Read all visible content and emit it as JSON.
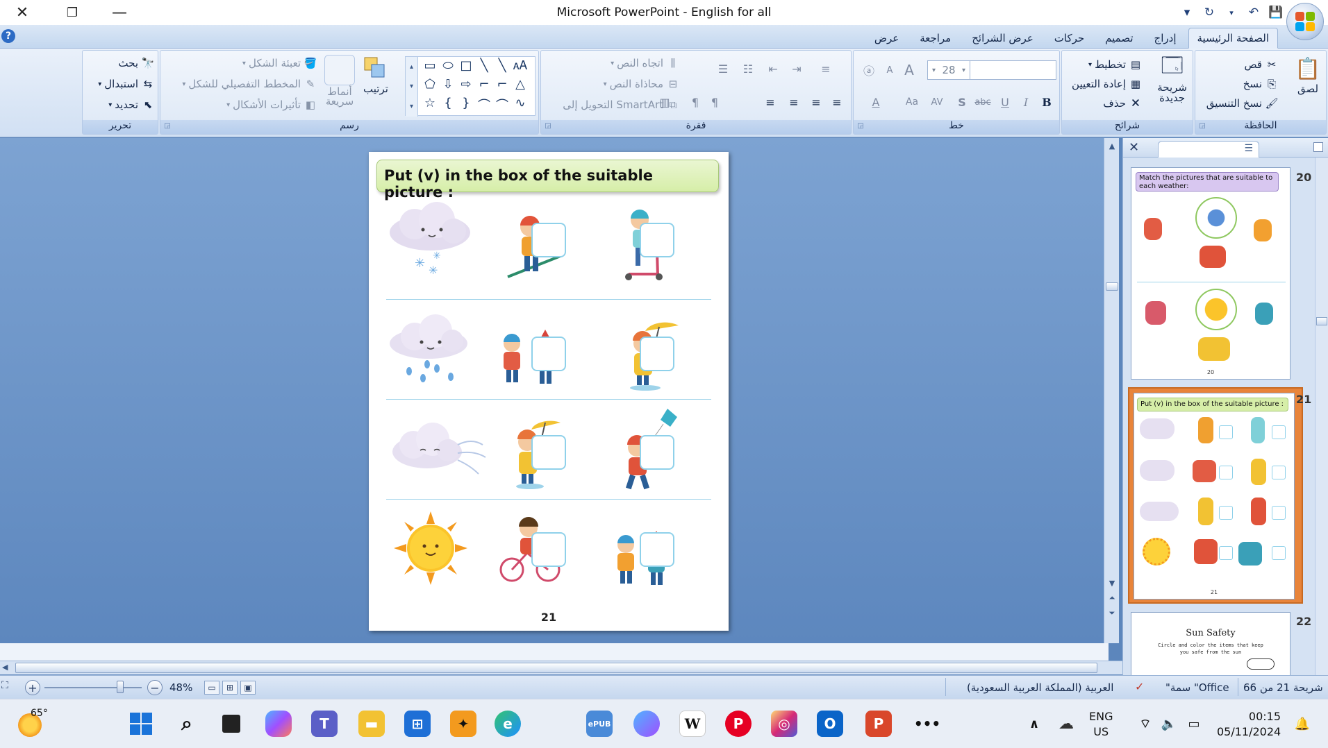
{
  "window": {
    "title": "Microsoft PowerPoint - English for all"
  },
  "tabs": [
    {
      "label": "الصفحة الرئيسية",
      "active": true
    },
    {
      "label": "إدراج"
    },
    {
      "label": "تصميم"
    },
    {
      "label": "حركات"
    },
    {
      "label": "عرض الشرائح"
    },
    {
      "label": "مراجعة"
    },
    {
      "label": "عرض"
    }
  ],
  "ribbon": {
    "clipboard": {
      "label": "الحافظة",
      "paste": "لصق",
      "cut": "قص",
      "copy": "نسخ",
      "format_painter": "نسخ التنسيق"
    },
    "slides": {
      "label": "شرائح",
      "new_slide_1": "شريحة",
      "new_slide_2": "جديدة",
      "layout": "تخطيط",
      "reset": "إعادة التعيين",
      "delete": "حذف"
    },
    "font": {
      "label": "خط",
      "size": "28",
      "bold": "B",
      "italic": "I",
      "underline": "U",
      "strike": "abc",
      "shadow": "S",
      "spacing": "AV",
      "change_case": "Aa",
      "font_color": "A",
      "grow": "A",
      "shrink": "A"
    },
    "paragraph": {
      "label": "فقرة",
      "text_direction": "اتجاه النص",
      "align_text": "محاذاة النص",
      "smartart": "التحويل إلى SmartArt"
    },
    "drawing": {
      "label": "رسم",
      "arrange": "ترتيب",
      "quick_styles_1": "أنماط",
      "quick_styles_2": "سريعة",
      "shape_fill": "تعبئة الشكل",
      "shape_outline": "المخطط التفصيلي للشكل",
      "shape_effects": "تأثيرات الأشكال"
    },
    "editing": {
      "label": "تحرير",
      "find": "بحث",
      "replace": "استبدال",
      "select": "تحديد"
    }
  },
  "slide": {
    "title": "Put (v) in the box of the suitable picture :",
    "number": "21"
  },
  "panel": {
    "thumbs": [
      {
        "num": "20",
        "title": "Match the pictures that are suitable to each weather:",
        "page": "20"
      },
      {
        "num": "21",
        "title": "Put (v) in the box of the suitable picture :",
        "page": "21"
      },
      {
        "num": "22",
        "title": "Sun Safety",
        "subtitle": "Circle and color the items that keep you safe from the sun"
      }
    ]
  },
  "statusbar": {
    "slide_info": "شريحة 21 من 66",
    "theme": "\"سمة \"Office",
    "language": "العربية (المملكة العربية السعودية)",
    "zoom": "48%"
  },
  "taskbar": {
    "weather_temp": "65°",
    "lang_line1": "ENG",
    "lang_line2": "US",
    "time": "00:15",
    "date": "05/11/2024"
  },
  "colors": {
    "ribbon_bg": "#dde8f6",
    "workspace": "#6f96c9",
    "selected_thumb": "#e8843a",
    "title_box": "#d6eea8"
  }
}
